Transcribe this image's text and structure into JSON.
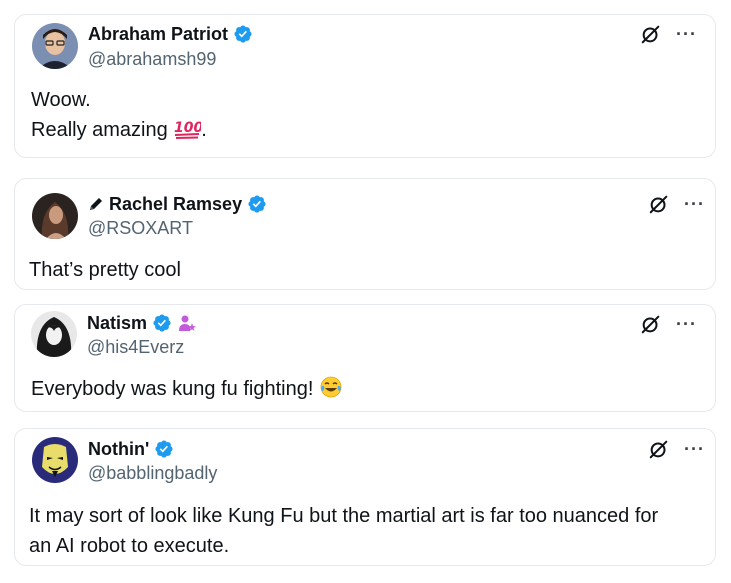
{
  "posts": [
    {
      "author": {
        "display_name": "Abraham Patriot",
        "handle": "@abrahamsh99",
        "verified": true
      },
      "text_lines": [
        "Woow.",
        "Really amazing"
      ],
      "trailing_emoji": "hundred-points-emoji",
      "trailing_punct": "."
    },
    {
      "author": {
        "display_name": "Rachel Ramsey",
        "handle": "@RSOXART",
        "verified": true,
        "prefix_icon": "pencil-icon"
      },
      "text_lines": [
        "That’s pretty cool"
      ]
    },
    {
      "author": {
        "display_name": "Natism",
        "handle": "@his4Everz",
        "verified": true,
        "suffix_icon": "person-sparkle-icon"
      },
      "text_lines": [
        "Everybody was kung fu fighting!"
      ],
      "trailing_emoji": "tears-of-joy-emoji"
    },
    {
      "author": {
        "display_name": "Nothin'",
        "handle": "@babblingbadly",
        "verified": true
      },
      "text_lines": [
        "It may sort of look like Kung Fu but the martial art is far too nuanced for",
        "an AI robot to execute."
      ]
    }
  ],
  "icons": {
    "actions": [
      "grok-icon",
      "more-options-icon"
    ],
    "verified": "verified-badge-icon"
  },
  "colors": {
    "verified": "#1d9bf0",
    "handle": "#536471",
    "border": "#e6e9ec",
    "text": "#0f1419",
    "hundred": "#e0245e",
    "sparkle": "#c35adb"
  }
}
